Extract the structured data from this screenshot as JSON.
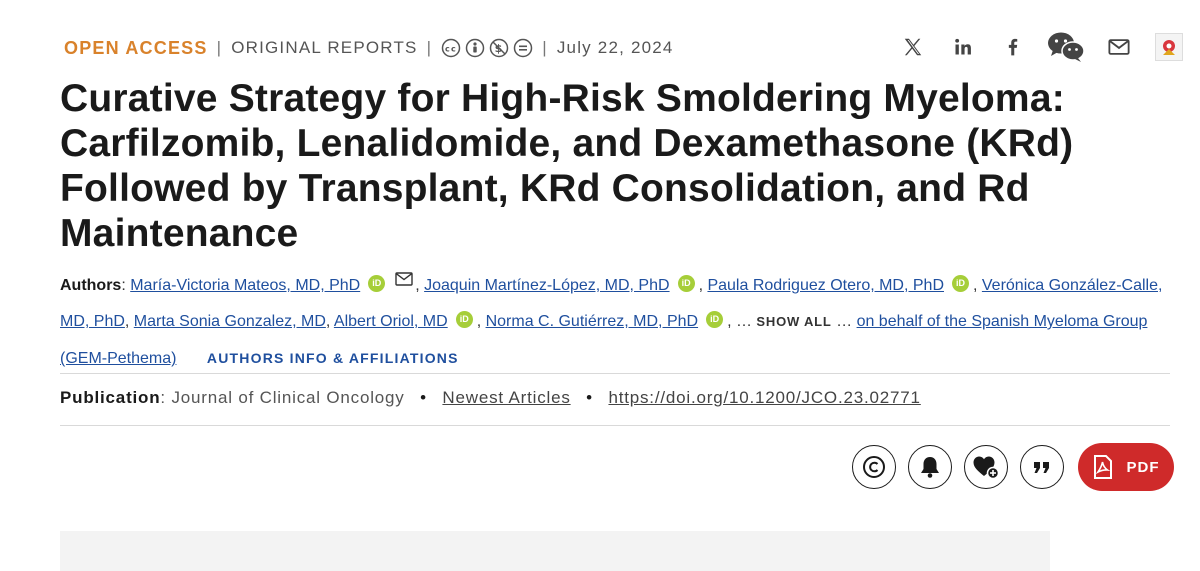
{
  "meta": {
    "access": "OPEN ACCESS",
    "separator": "|",
    "category": "ORIGINAL REPORTS",
    "date": "July 22, 2024"
  },
  "title": "Curative Strategy for High-Risk Smoldering Myeloma: Carfilzomib, Lenalidomide, and Dexamethasone (KRd) Followed by Transplant, KRd Consolidation, and Rd Maintenance",
  "authors": {
    "label": "Authors",
    "orcid_badge": "iD",
    "list": [
      "María-Victoria Mateos, MD, PhD",
      "Joaquin Martínez-López, MD, PhD",
      "Paula Rodriguez Otero, MD, PhD",
      "Verónica González-Calle, MD, PhD",
      "Marta Sonia Gonzalez, MD",
      "Albert Oriol, MD",
      "Norma C. Gutiérrez, MD, PhD"
    ],
    "ellipsis": "…",
    "show_all": "SHOW ALL",
    "group": "on behalf of the Spanish Myeloma Group (GEM-Pethema)",
    "info_link": "AUTHORS INFO & AFFILIATIONS"
  },
  "publication": {
    "label": "Publication",
    "journal": "Journal of Clinical Oncology",
    "bullet": "•",
    "section": "Newest Articles",
    "doi": "https://doi.org/10.1200/JCO.23.02771"
  },
  "share_icons": [
    "x-icon",
    "linkedin-icon",
    "facebook-icon",
    "wechat-icon",
    "email-icon",
    "mendeley-icon"
  ],
  "tools": {
    "pdf_label": "PDF",
    "pdf_color": "#cf2a2a",
    "access_color": "#d9822b",
    "link_color": "#1f4f9e"
  }
}
